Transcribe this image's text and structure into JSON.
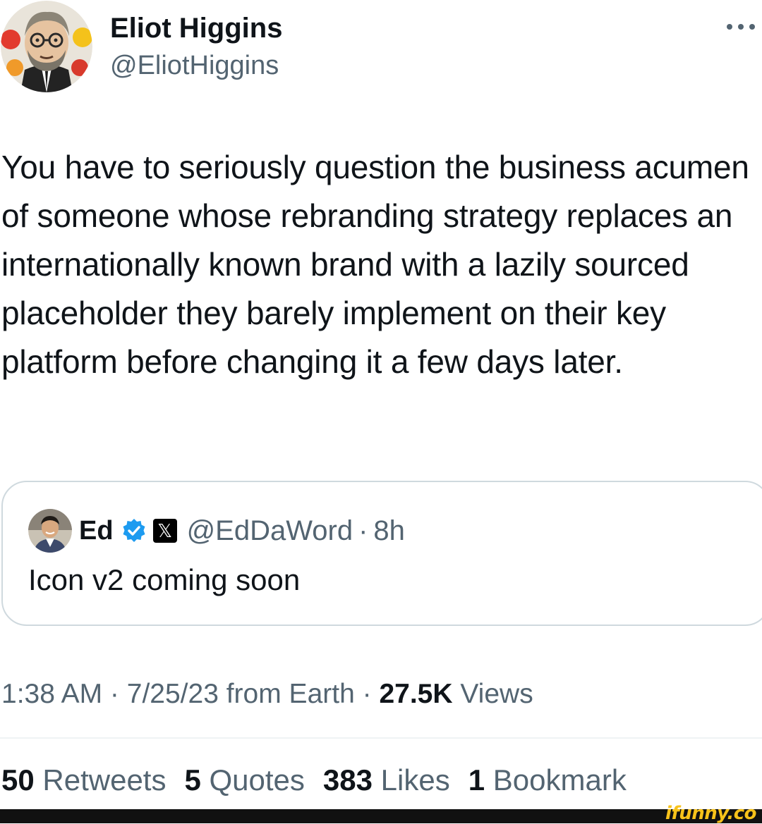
{
  "author": {
    "name": "Eliot Higgins",
    "handle": "@EliotHiggins"
  },
  "tweet": {
    "text": "You have to seriously question the business acumen of someone whose rebranding strategy replaces an internationally known brand with a lazily sourced placeholder they barely implement on their key platform before changing it a few days later."
  },
  "quote": {
    "name": "Ed",
    "handle": "@EdDaWord",
    "separator": "·",
    "time": "8h",
    "x_badge": "𝕏",
    "text": "Icon v2 coming soon"
  },
  "meta": {
    "time": "1:38 AM",
    "sep1": " · ",
    "date": "7/25/23",
    "source": " from Earth",
    "sep2": " · ",
    "views_count": "27.5K",
    "views_label": " Views"
  },
  "stats": [
    {
      "count": "50",
      "label": "Retweets"
    },
    {
      "count": "5",
      "label": "Quotes"
    },
    {
      "count": "383",
      "label": "Likes"
    },
    {
      "count": "1",
      "label": "Bookmark"
    }
  ],
  "watermark": "ifunny.co",
  "colors": {
    "text_primary": "#0f1419",
    "text_secondary": "#536471",
    "border": "#cfd9de",
    "verified_blue": "#1d9bf0",
    "watermark_yellow": "#f7c21a"
  },
  "icons": {
    "more": "more-horizontal-icon",
    "verified": "verified-badge-icon",
    "affiliate": "x-logo-icon"
  }
}
